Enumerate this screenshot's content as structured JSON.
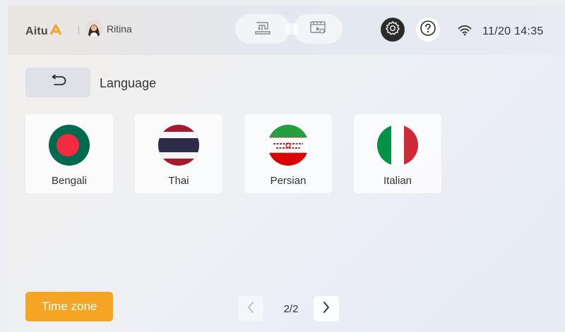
{
  "header": {
    "brand": "Aitu",
    "user_name": "Ritina",
    "datetime": "11/20 14:35",
    "icons": {
      "brand_mark": "aitu-logo-mark",
      "mode_1": "sewing-machine-icon",
      "mode_2": "video-player-icon",
      "settings": "gear-icon",
      "help": "question-icon",
      "wifi": "wifi-icon"
    }
  },
  "page": {
    "title": "Language",
    "back_icon": "undo-arrow-icon"
  },
  "languages": [
    {
      "label": "Bengali",
      "flag": "bangladesh-flag"
    },
    {
      "label": "Thai",
      "flag": "thailand-flag"
    },
    {
      "label": "Persian",
      "flag": "iran-flag"
    },
    {
      "label": "Italian",
      "flag": "italy-flag"
    }
  ],
  "footer": {
    "time_zone_label": "Time zone",
    "pager": "2/2"
  },
  "colors": {
    "accent": "#f5a524",
    "brand_orange": "#f5a524",
    "settings_bg": "#2b2b2b"
  }
}
